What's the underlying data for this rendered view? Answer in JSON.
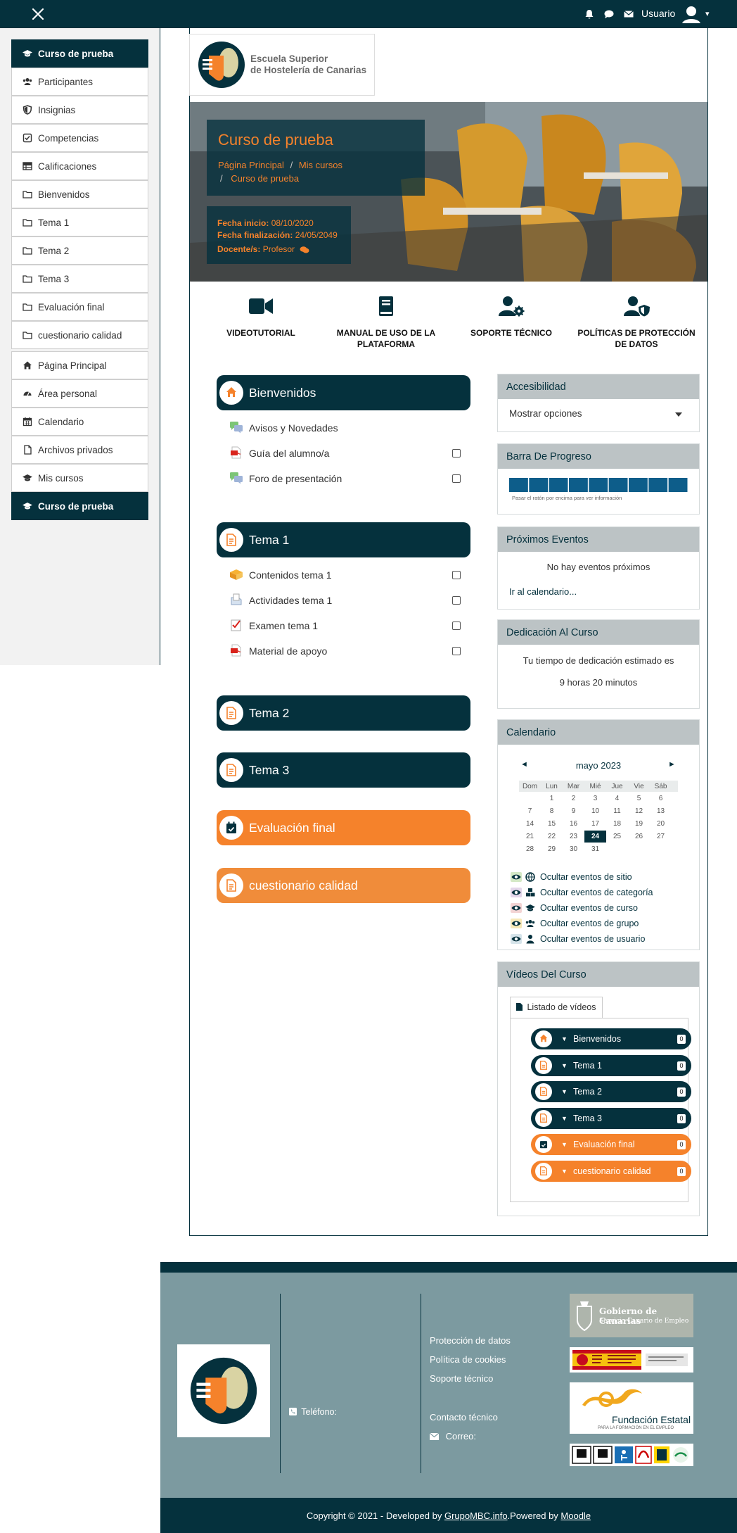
{
  "topbar": {
    "user_name": "Usuario",
    "user_caret": "▾"
  },
  "drawer": {
    "items": [
      {
        "label": "Curso de prueba",
        "icon": "graduation-cap-icon",
        "active": true
      },
      {
        "label": "Participantes",
        "icon": "users-icon"
      },
      {
        "label": "Insignias",
        "icon": "shield-icon"
      },
      {
        "label": "Competencias",
        "icon": "checkbox-icon"
      },
      {
        "label": "Calificaciones",
        "icon": "table-icon"
      },
      {
        "label": "Bienvenidos",
        "icon": "folder-icon"
      },
      {
        "label": "Tema 1",
        "icon": "folder-icon"
      },
      {
        "label": "Tema 2",
        "icon": "folder-icon"
      },
      {
        "label": "Tema 3",
        "icon": "folder-icon"
      },
      {
        "label": "Evaluación final",
        "icon": "folder-icon"
      },
      {
        "label": "cuestionario calidad",
        "icon": "folder-icon"
      },
      {
        "label": "Página Principal",
        "icon": "home-icon"
      },
      {
        "label": "Área personal",
        "icon": "dashboard-icon"
      },
      {
        "label": "Calendario",
        "icon": "calendar-icon"
      },
      {
        "label": "Archivos privados",
        "icon": "file-icon"
      },
      {
        "label": "Mis cursos",
        "icon": "graduation-cap-icon"
      },
      {
        "label": "Curso de prueba",
        "icon": "graduation-cap-icon",
        "active": true
      }
    ]
  },
  "logo": {
    "line1": "Escuela Superior",
    "line2": "de Hostelería de Canarias"
  },
  "hero": {
    "title": "Curso de prueba",
    "breadcrumb": [
      "Página Principal",
      "Mis cursos",
      "Curso de prueba"
    ],
    "breadcrumb_sep": "/",
    "start_label": "Fecha inicio:",
    "start_value": "08/10/2020",
    "end_label": "Fecha finalización:",
    "end_value": "24/05/2049",
    "teacher_label": "Docente/s:",
    "teacher_value": "Profesor"
  },
  "quick_links": [
    {
      "label": "VIDEOTUTORIAL",
      "icon": "video-camera-icon"
    },
    {
      "label": "MANUAL DE USO DE LA PLATAFORMA",
      "icon": "book-icon"
    },
    {
      "label": "SOPORTE TÉCNICO",
      "icon": "user-gear-icon"
    },
    {
      "label": "POLÍTICAS DE PROTECCIÓN DE DATOS",
      "icon": "user-shield-icon"
    }
  ],
  "sections": [
    {
      "title": "Bienvenidos",
      "icon": "home-icon",
      "color": "#05313d",
      "activities": [
        {
          "name": "Avisos y Novedades",
          "icon": "forum-icon",
          "checkbox": false
        },
        {
          "name": "Guía del alumno/a",
          "icon": "pdf-icon",
          "checkbox": true
        },
        {
          "name": "Foro de presentación",
          "icon": "forum-icon",
          "checkbox": true
        }
      ]
    },
    {
      "title": "Tema 1",
      "icon": "document-icon",
      "color": "#05313d",
      "activities": [
        {
          "name": "Contenidos tema 1",
          "icon": "scorm-package-icon",
          "checkbox": true
        },
        {
          "name": "Actividades tema 1",
          "icon": "assignment-icon",
          "checkbox": true
        },
        {
          "name": "Examen tema 1",
          "icon": "quiz-icon",
          "checkbox": true
        },
        {
          "name": "Material de apoyo",
          "icon": "pdf-icon",
          "checkbox": true
        }
      ]
    },
    {
      "title": "Tema 2",
      "icon": "document-icon",
      "color": "#05313d",
      "activities": []
    },
    {
      "title": "Tema 3",
      "icon": "document-icon",
      "color": "#05313d",
      "activities": []
    },
    {
      "title": "Evaluación final",
      "icon": "calendar-check-icon",
      "color": "#f5822b",
      "activities": []
    },
    {
      "title": "cuestionario calidad",
      "icon": "document-icon",
      "color": "#f08c3a",
      "activities": []
    }
  ],
  "blocks": {
    "accessibility": {
      "title": "Accesibilidad",
      "select_value": "Mostrar opciones"
    },
    "progress": {
      "title": "Barra De Progreso",
      "segments": 9,
      "completed": 0,
      "hint": "Pasar el ratón por encima para ver información"
    },
    "events": {
      "title": "Próximos Eventos",
      "empty": "No hay eventos próximos",
      "link": "Ir al calendario..."
    },
    "dedication": {
      "title": "Dedicación Al Curso",
      "line1": "Tu tiempo de dedicación estimado es",
      "line2": "9 horas 20 minutos"
    },
    "calendar": {
      "title": "Calendario",
      "month": "mayo 2023",
      "prev": "◄",
      "next": "►",
      "weekdays": [
        "Dom",
        "Lun",
        "Mar",
        "Mié",
        "Jue",
        "Vie",
        "Sáb"
      ],
      "weeks": [
        [
          "",
          "1",
          "2",
          "3",
          "4",
          "5",
          "6"
        ],
        [
          "7",
          "8",
          "9",
          "10",
          "11",
          "12",
          "13"
        ],
        [
          "14",
          "15",
          "16",
          "17",
          "18",
          "19",
          "20"
        ],
        [
          "21",
          "22",
          "23",
          "24",
          "25",
          "26",
          "27"
        ],
        [
          "28",
          "29",
          "30",
          "31",
          "",
          "",
          ""
        ]
      ],
      "today": "24",
      "filters": [
        {
          "label": "Ocultar eventos de sitio",
          "icon": "globe-icon"
        },
        {
          "label": "Ocultar eventos de categoría",
          "icon": "cubes-icon"
        },
        {
          "label": "Ocultar eventos de curso",
          "icon": "graduation-cap-icon"
        },
        {
          "label": "Ocultar eventos de grupo",
          "icon": "users-icon"
        },
        {
          "label": "Ocultar eventos de usuario",
          "icon": "user-icon"
        }
      ]
    },
    "videos": {
      "title": "Vídeos Del Curso",
      "tab": "Listado de vídeos",
      "items": [
        {
          "label": "Bienvenidos",
          "count": "0",
          "color": "#05313d",
          "icon": "home-icon"
        },
        {
          "label": "Tema 1",
          "count": "0",
          "color": "#05313d",
          "icon": "document-icon"
        },
        {
          "label": "Tema 2",
          "count": "0",
          "color": "#05313d",
          "icon": "document-icon"
        },
        {
          "label": "Tema 3",
          "count": "0",
          "color": "#05313d",
          "icon": "document-icon"
        },
        {
          "label": "Evaluación final",
          "count": "0",
          "color": "#f5822b",
          "icon": "calendar-check-icon"
        },
        {
          "label": "cuestionario calidad",
          "count": "0",
          "color": "#f5822b",
          "icon": "document-icon"
        }
      ]
    }
  },
  "footer": {
    "phone_label": "Teléfono:",
    "links": [
      "Protección de datos",
      "Política de cookies",
      "Soporte técnico"
    ],
    "contact_title": "Contacto técnico",
    "email_label": "Correo:",
    "logos": {
      "gobierno_line1": "Gobierno de Canarias",
      "gobierno_line2": "Servicio Canario de Empleo",
      "fundacion_line1": "Fundación Estatal",
      "fundacion_line2": "PARA LA FORMACIÓN EN EL EMPLEO"
    },
    "copyright_prefix": "Copyright © 2021 - Developed by ",
    "copyright_link": "GrupoMBC.info",
    "powered_prefix": ".Powered by ",
    "powered_link": "Moodle"
  },
  "colors": {
    "primary": "#05313d",
    "accent": "#f5822b",
    "block_header": "#bcc3c5",
    "footer_bg": "#7c9aa0"
  }
}
